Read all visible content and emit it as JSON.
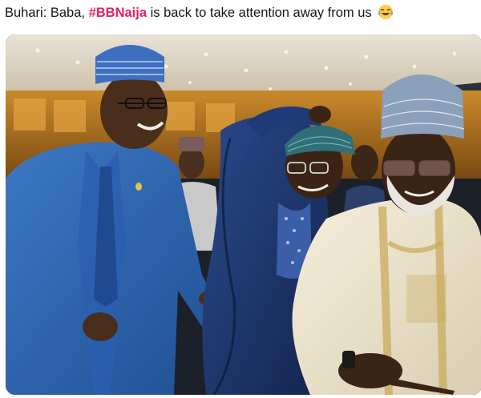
{
  "tweet": {
    "text_before": "Buhari: Baba, ",
    "hashtag": "#BBNaija",
    "text_after": " is back to take attention away from us",
    "emoji": "face-with-tears-of-joy-icon"
  },
  "media": {
    "type": "photo",
    "subject_icon": "people-laughing-photo"
  },
  "colors": {
    "hashtag": "#e0245e",
    "text": "#14171a"
  }
}
